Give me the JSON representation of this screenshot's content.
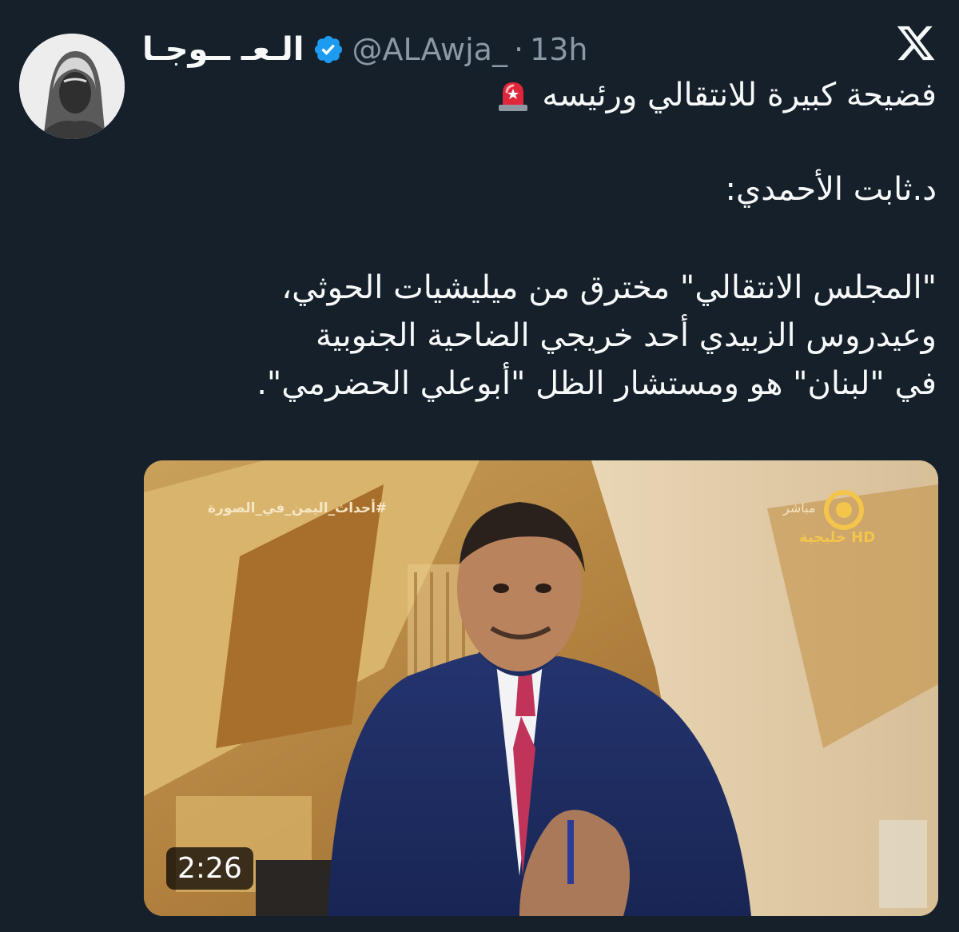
{
  "user": {
    "display_name": "الـعـ ــوجـا",
    "handle": "@ALAwja_",
    "separator": "·",
    "time": "13h"
  },
  "icons": {
    "brand": "x-logo-icon",
    "verified": "verified-badge-icon",
    "siren": "rotating-light-icon"
  },
  "tweet": {
    "line1": "فضيحة كبيرة للانتقالي ورئيسه",
    "line2": "د.ثابت الأحمدي:",
    "paragraph": [
      "\"المجلس الانتقالي\" مخترق من ميليشيات الحوثي،",
      "وعيدروس الزبيدي أحد خريجي الضاحية الجنوبية",
      "في \"لبنان\" هو ومستشار الظل \"أبوعلي الحضرمي\"."
    ]
  },
  "media": {
    "hashtag": "#أحداث_اليمن_في_الصورة",
    "live_label": "مباشر",
    "channel": "خليجية HD",
    "duration": "2:26"
  },
  "colors": {
    "background": "#15202b",
    "text": "#f7f9f9",
    "secondary": "#8b98a5",
    "verified": "#1d9bf0"
  }
}
